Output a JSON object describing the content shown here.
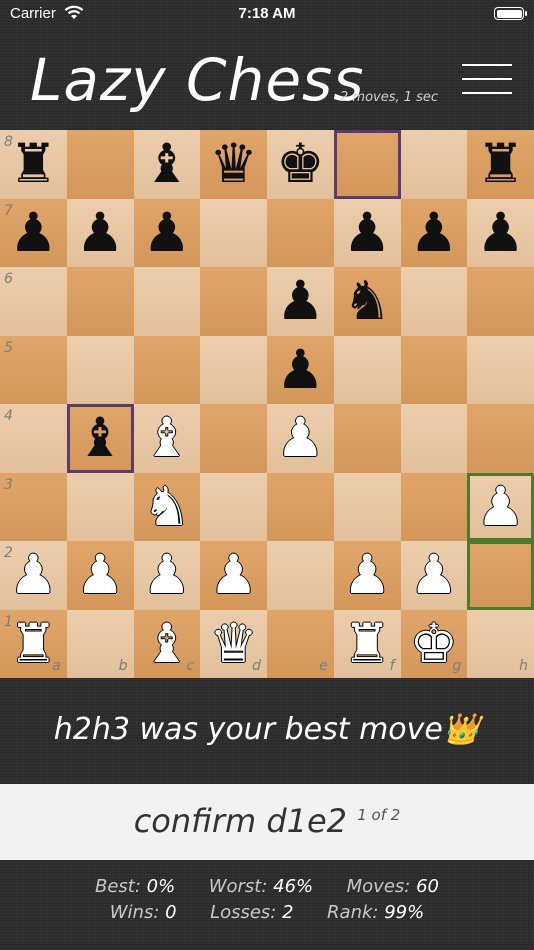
{
  "status_bar": {
    "carrier": "Carrier",
    "time": "7:18 AM"
  },
  "header": {
    "title": "Lazy Chess",
    "subtitle": "2 moves, 1 sec"
  },
  "board": {
    "files": [
      "a",
      "b",
      "c",
      "d",
      "e",
      "f",
      "g",
      "h"
    ],
    "ranks": [
      "8",
      "7",
      "6",
      "5",
      "4",
      "3",
      "2",
      "1"
    ],
    "light_color": "#e9c6a0",
    "dark_color": "#de9f5f",
    "pieces": [
      {
        "square": "a8",
        "piece": "black-rook",
        "glyph": "♜"
      },
      {
        "square": "c8",
        "piece": "black-bishop",
        "glyph": "♝"
      },
      {
        "square": "d8",
        "piece": "black-queen",
        "glyph": "♛"
      },
      {
        "square": "e8",
        "piece": "black-king",
        "glyph": "♚"
      },
      {
        "square": "h8",
        "piece": "black-rook",
        "glyph": "♜"
      },
      {
        "square": "a7",
        "piece": "black-pawn",
        "glyph": "♟"
      },
      {
        "square": "b7",
        "piece": "black-pawn",
        "glyph": "♟"
      },
      {
        "square": "c7",
        "piece": "black-pawn",
        "glyph": "♟"
      },
      {
        "square": "f7",
        "piece": "black-pawn",
        "glyph": "♟"
      },
      {
        "square": "g7",
        "piece": "black-pawn",
        "glyph": "♟"
      },
      {
        "square": "h7",
        "piece": "black-pawn",
        "glyph": "♟"
      },
      {
        "square": "e6",
        "piece": "black-pawn",
        "glyph": "♟"
      },
      {
        "square": "f6",
        "piece": "black-knight",
        "glyph": "♞"
      },
      {
        "square": "e5",
        "piece": "black-pawn",
        "glyph": "♟"
      },
      {
        "square": "b4",
        "piece": "black-bishop",
        "glyph": "♝"
      },
      {
        "square": "c4",
        "piece": "white-bishop",
        "glyph": "♝"
      },
      {
        "square": "e4",
        "piece": "white-pawn",
        "glyph": "♟"
      },
      {
        "square": "c3",
        "piece": "white-knight",
        "glyph": "♞"
      },
      {
        "square": "h3",
        "piece": "white-pawn",
        "glyph": "♟"
      },
      {
        "square": "a2",
        "piece": "white-pawn",
        "glyph": "♟"
      },
      {
        "square": "b2",
        "piece": "white-pawn",
        "glyph": "♟"
      },
      {
        "square": "c2",
        "piece": "white-pawn",
        "glyph": "♟"
      },
      {
        "square": "d2",
        "piece": "white-pawn",
        "glyph": "♟"
      },
      {
        "square": "f2",
        "piece": "white-pawn",
        "glyph": "♟"
      },
      {
        "square": "g2",
        "piece": "white-pawn",
        "glyph": "♟"
      },
      {
        "square": "a1",
        "piece": "white-rook",
        "glyph": "♜"
      },
      {
        "square": "c1",
        "piece": "white-bishop",
        "glyph": "♝"
      },
      {
        "square": "d1",
        "piece": "white-queen",
        "glyph": "♛"
      },
      {
        "square": "f1",
        "piece": "white-rook",
        "glyph": "♜"
      },
      {
        "square": "g1",
        "piece": "white-king",
        "glyph": "♚"
      }
    ],
    "highlights": [
      {
        "square": "f8",
        "color": "purple"
      },
      {
        "square": "b4",
        "color": "purple"
      },
      {
        "square": "h3",
        "color": "green"
      },
      {
        "square": "h2",
        "color": "green"
      }
    ]
  },
  "message": {
    "move": "h2h3",
    "middle": "was your",
    "rating": "best",
    "end": "move",
    "emoji": "👑"
  },
  "confirm": {
    "label": "confirm",
    "move": "d1e2",
    "count": "1 of 2"
  },
  "stats": {
    "best_label": "Best:",
    "best_value": "0%",
    "worst_label": "Worst:",
    "worst_value": "46%",
    "moves_label": "Moves:",
    "moves_value": "60",
    "wins_label": "Wins:",
    "wins_value": "0",
    "losses_label": "Losses:",
    "losses_value": "2",
    "rank_label": "Rank:",
    "rank_value": "99%"
  }
}
